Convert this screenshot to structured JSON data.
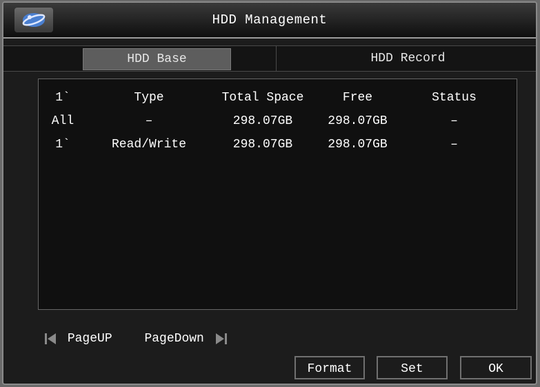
{
  "window": {
    "title": "HDD Management",
    "icon": "app-logo-icon"
  },
  "tabs": [
    {
      "label": "HDD Base",
      "active": true
    },
    {
      "label": "HDD Record",
      "active": false
    }
  ],
  "table": {
    "headers": [
      "1`",
      "Type",
      "Total Space",
      "Free",
      "Status"
    ],
    "rows": [
      [
        "All",
        "–",
        "298.07GB",
        "298.07GB",
        "–"
      ],
      [
        "1`",
        "Read/Write",
        "298.07GB",
        "298.07GB",
        "–"
      ]
    ]
  },
  "pager": {
    "prev_label": "PageUP",
    "next_label": "PageDown",
    "prev_icon": "page-prev-icon",
    "next_icon": "page-next-icon"
  },
  "buttons": {
    "format": "Format",
    "set": "Set",
    "ok": "OK"
  }
}
